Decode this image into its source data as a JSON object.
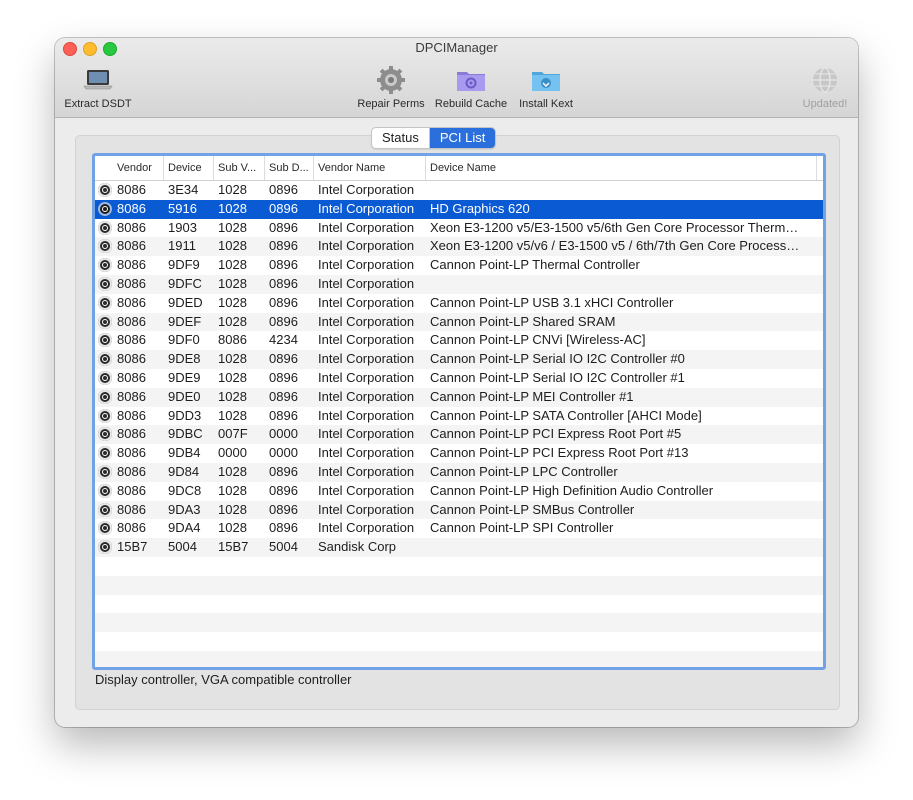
{
  "window": {
    "title": "DPCIManager"
  },
  "toolbar": {
    "extract_dsdt": {
      "label": "Extract DSDT",
      "icon": "laptop-icon"
    },
    "repair_perms": {
      "label": "Repair Perms",
      "icon": "gear-icon"
    },
    "rebuild_cache": {
      "label": "Rebuild Cache",
      "icon": "gear-folder-icon"
    },
    "install_kext": {
      "label": "Install Kext",
      "icon": "install-folder-icon"
    },
    "update_status": {
      "label": "Updated!",
      "icon": "globe-icon"
    }
  },
  "tabs": {
    "status": "Status",
    "pci_list": "PCI List",
    "selected": "PCI List"
  },
  "table": {
    "columns": [
      "Vendor",
      "Device",
      "Sub V...",
      "Sub D...",
      "Vendor Name",
      "Device Name"
    ],
    "selected_index": 1,
    "rows": [
      [
        "8086",
        "3E34",
        "1028",
        "0896",
        "Intel Corporation",
        ""
      ],
      [
        "8086",
        "5916",
        "1028",
        "0896",
        "Intel Corporation",
        "HD Graphics 620"
      ],
      [
        "8086",
        "1903",
        "1028",
        "0896",
        "Intel Corporation",
        "Xeon E3-1200 v5/E3-1500 v5/6th Gen Core Processor Therm…"
      ],
      [
        "8086",
        "1911",
        "1028",
        "0896",
        "Intel Corporation",
        "Xeon E3-1200 v5/v6 / E3-1500 v5 / 6th/7th Gen Core Process…"
      ],
      [
        "8086",
        "9DF9",
        "1028",
        "0896",
        "Intel Corporation",
        "Cannon Point-LP Thermal Controller"
      ],
      [
        "8086",
        "9DFC",
        "1028",
        "0896",
        "Intel Corporation",
        ""
      ],
      [
        "8086",
        "9DED",
        "1028",
        "0896",
        "Intel Corporation",
        "Cannon Point-LP USB 3.1 xHCI Controller"
      ],
      [
        "8086",
        "9DEF",
        "1028",
        "0896",
        "Intel Corporation",
        "Cannon Point-LP Shared SRAM"
      ],
      [
        "8086",
        "9DF0",
        "8086",
        "4234",
        "Intel Corporation",
        "Cannon Point-LP CNVi [Wireless-AC]"
      ],
      [
        "8086",
        "9DE8",
        "1028",
        "0896",
        "Intel Corporation",
        "Cannon Point-LP Serial IO I2C Controller #0"
      ],
      [
        "8086",
        "9DE9",
        "1028",
        "0896",
        "Intel Corporation",
        "Cannon Point-LP Serial IO I2C Controller #1"
      ],
      [
        "8086",
        "9DE0",
        "1028",
        "0896",
        "Intel Corporation",
        "Cannon Point-LP MEI Controller #1"
      ],
      [
        "8086",
        "9DD3",
        "1028",
        "0896",
        "Intel Corporation",
        "Cannon Point-LP SATA Controller [AHCI Mode]"
      ],
      [
        "8086",
        "9DBC",
        "007F",
        "0000",
        "Intel Corporation",
        "Cannon Point-LP PCI Express Root Port #5"
      ],
      [
        "8086",
        "9DB4",
        "0000",
        "0000",
        "Intel Corporation",
        "Cannon Point-LP PCI Express Root Port #13"
      ],
      [
        "8086",
        "9D84",
        "1028",
        "0896",
        "Intel Corporation",
        "Cannon Point-LP LPC Controller"
      ],
      [
        "8086",
        "9DC8",
        "1028",
        "0896",
        "Intel Corporation",
        "Cannon Point-LP High Definition Audio Controller"
      ],
      [
        "8086",
        "9DA3",
        "1028",
        "0896",
        "Intel Corporation",
        "Cannon Point-LP SMBus Controller"
      ],
      [
        "8086",
        "9DA4",
        "1028",
        "0896",
        "Intel Corporation",
        "Cannon Point-LP SPI Controller"
      ],
      [
        "15B7",
        "5004",
        "15B7",
        "5004",
        "Sandisk Corp",
        ""
      ]
    ]
  },
  "status_text": "Display controller, VGA compatible controller"
}
